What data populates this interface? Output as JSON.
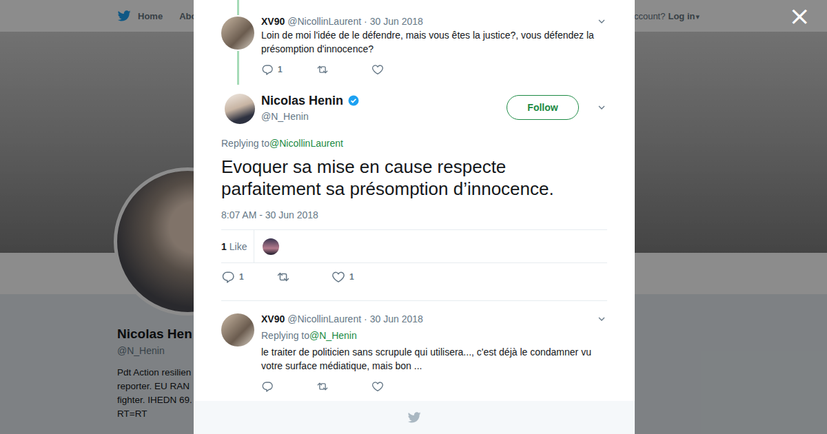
{
  "background": {
    "nav": [
      "Home",
      "Abo"
    ],
    "account_prompt": "account?",
    "login": "Log in",
    "login_caret": "▾",
    "profile": {
      "name": "Nicolas Hen",
      "handle": "@N_Henin",
      "bio": [
        "Pdt Action resilien",
        "reporter. EU RAN",
        "fighter. IHEDN 69.",
        "RT=RT"
      ]
    }
  },
  "modal": {
    "close": "×",
    "thread": [
      {
        "name": "XV90",
        "handle": "@NicollinLaurent",
        "dot": "·",
        "date": "30 Jun 2018",
        "text": "Loin de moi l'idée de le défendre, mais vous êtes la justice?, vous défendez la présomption d'innocence?",
        "replies": "1"
      }
    ],
    "focused": {
      "name": "Nicolas Henin",
      "handle": "@N_Henin",
      "verified": true,
      "follow_label": "Follow",
      "replying_label": "Replying to",
      "replying_to": "@NicollinLaurent",
      "text": "Evoquer sa mise en cause respecte parfaitement sa présomption d’innocence.",
      "timestamp": "8:07 AM - 30 Jun 2018",
      "like_count": "1",
      "like_label": "Like",
      "replies": "1",
      "likes": "1"
    },
    "replies": [
      {
        "name": "XV90",
        "handle": "@NicollinLaurent",
        "dot": "·",
        "date": "30 Jun 2018",
        "replying_label": "Replying to",
        "replying_to": "@N_Henin",
        "text": "le traiter de politicien sans scrupule qui utilisera..., c'est déjà le condamner vu votre surface médiatique, mais bon ..."
      }
    ]
  }
}
